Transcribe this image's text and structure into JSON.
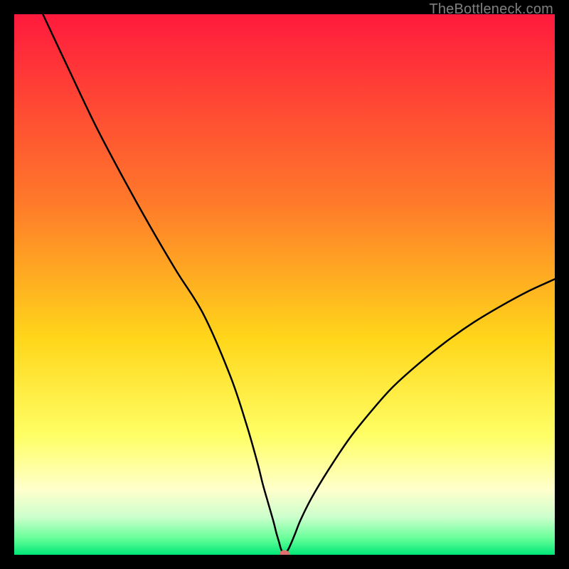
{
  "watermark": "TheBottleneck.com",
  "chart_data": {
    "type": "line",
    "title": "",
    "xlabel": "",
    "ylabel": "",
    "xlim": [
      0,
      100
    ],
    "ylim": [
      0,
      100
    ],
    "grid": false,
    "legend": false,
    "background_gradient_stops": [
      {
        "offset": 0,
        "color": "#ff1a3d"
      },
      {
        "offset": 35,
        "color": "#ff7a2a"
      },
      {
        "offset": 60,
        "color": "#ffd61a"
      },
      {
        "offset": 78,
        "color": "#ffff66"
      },
      {
        "offset": 88,
        "color": "#ffffcc"
      },
      {
        "offset": 93,
        "color": "#ccffcc"
      },
      {
        "offset": 97,
        "color": "#66ff99"
      },
      {
        "offset": 100,
        "color": "#00e676"
      }
    ],
    "series": [
      {
        "name": "bottleneck-curve",
        "stroke": "#000000",
        "stroke_width": 2.5,
        "x": [
          5.3,
          10,
          15,
          20,
          25,
          30,
          35,
          40,
          43,
          45,
          46,
          47,
          48,
          48.5,
          49,
          49.3,
          49.6,
          50,
          50.4,
          50.8,
          51.3,
          52,
          53,
          55,
          58,
          62,
          66,
          70,
          75,
          80,
          85,
          90,
          95,
          100
        ],
        "y": [
          100,
          90,
          79.5,
          70,
          61,
          52.5,
          44.5,
          33,
          24,
          17,
          13,
          9.5,
          6,
          4,
          2.3,
          1.2,
          0.55,
          0.2,
          0.55,
          1.2,
          2.3,
          4,
          6.5,
          10.5,
          15.5,
          21.5,
          26.5,
          31,
          35.5,
          39.5,
          43,
          46,
          48.7,
          51
        ]
      }
    ],
    "marker": {
      "name": "minimum-point",
      "x": 50,
      "y": 0.2,
      "rx": 7,
      "ry": 5,
      "color": "#e07070"
    }
  }
}
